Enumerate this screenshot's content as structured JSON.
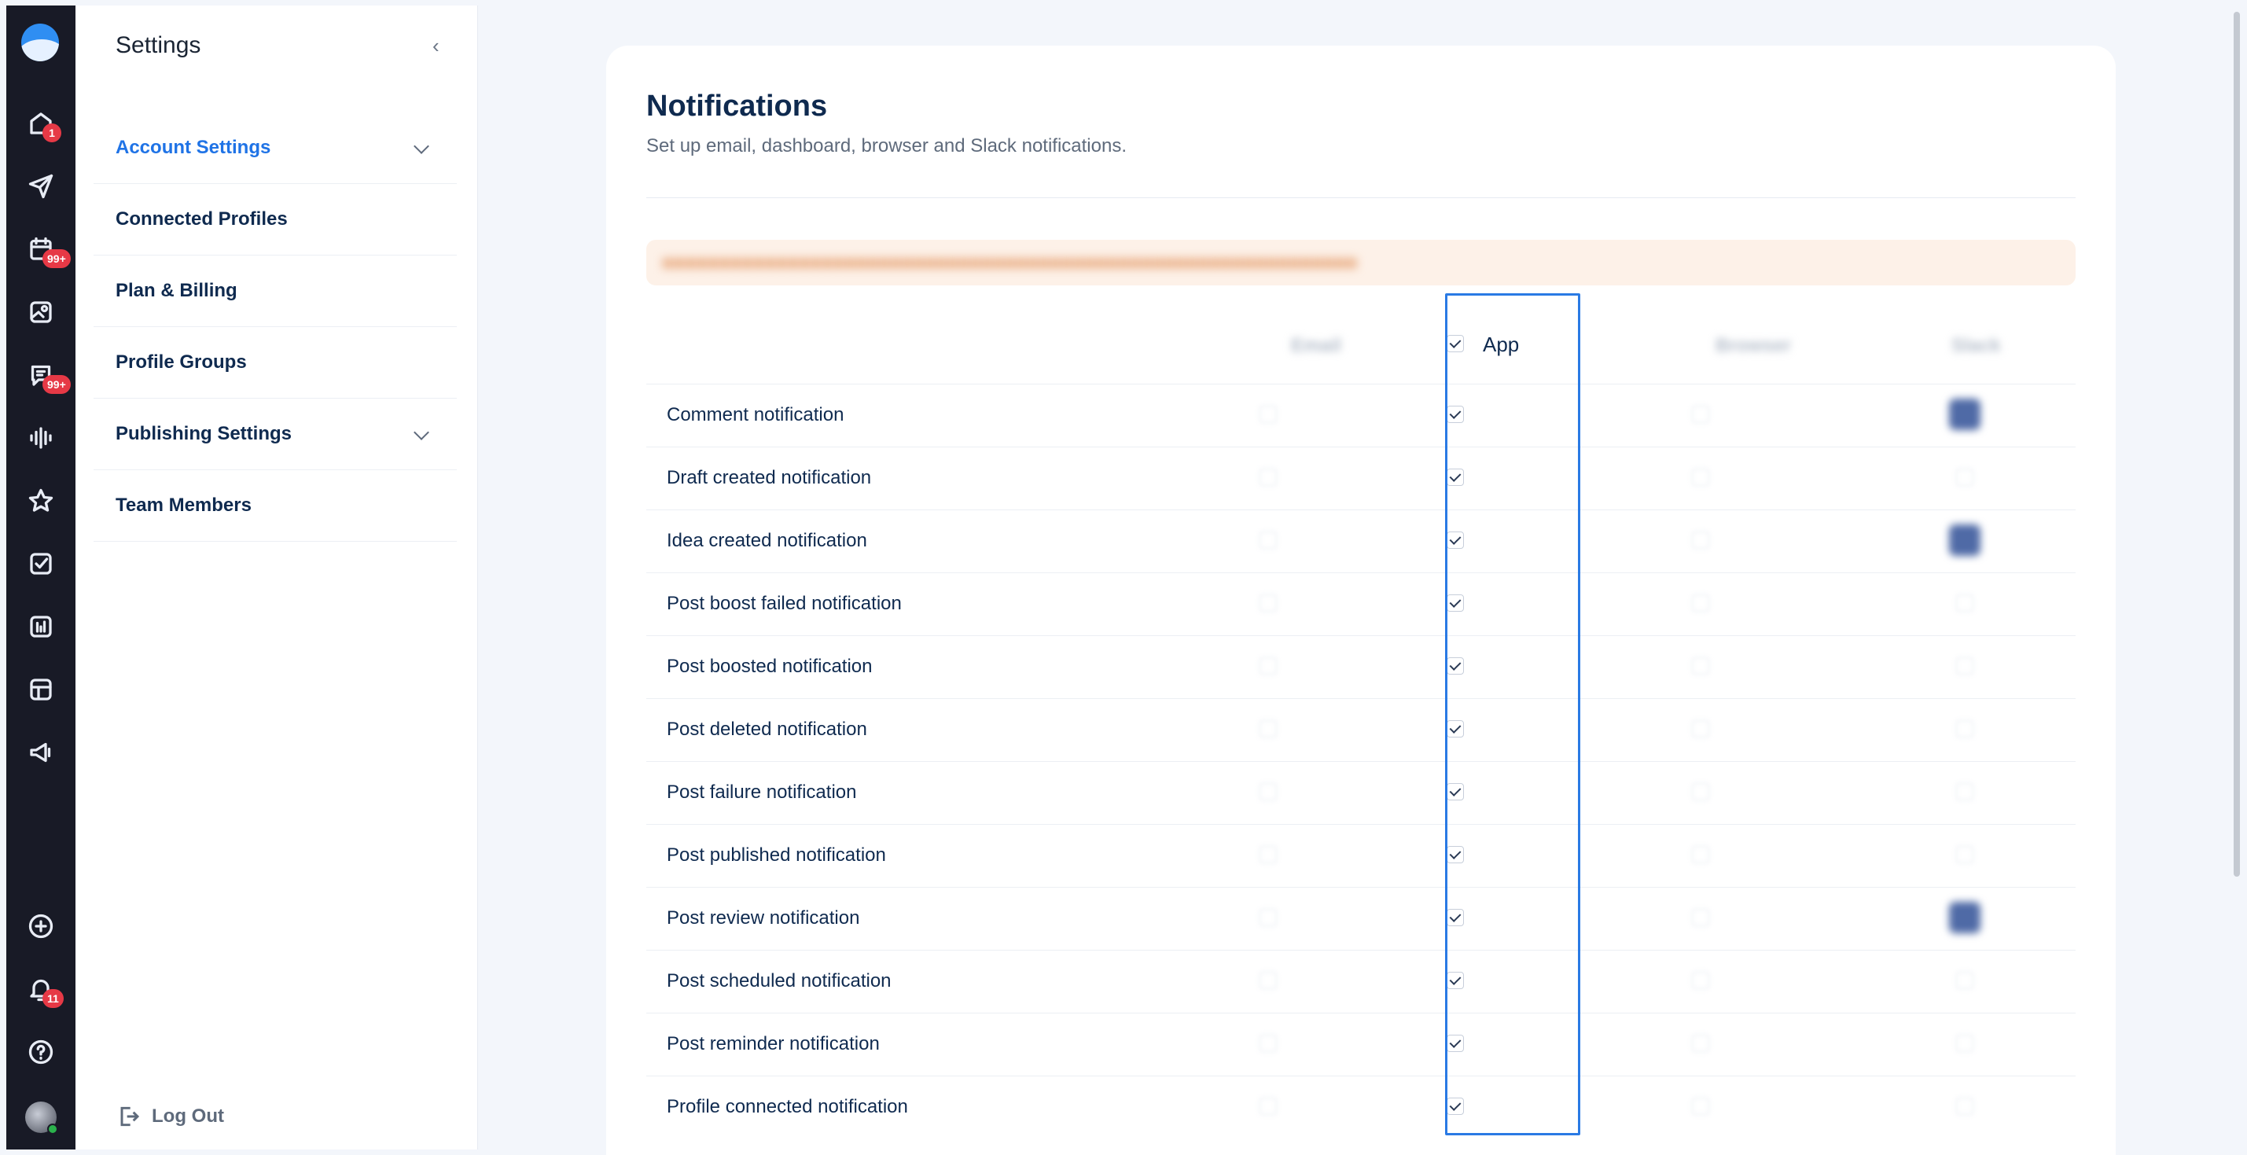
{
  "rail": {
    "items": [
      {
        "icon": "home-icon",
        "badge": "1"
      },
      {
        "icon": "send-icon",
        "badge": ""
      },
      {
        "icon": "calendar-icon",
        "badge": "99+"
      },
      {
        "icon": "media-icon",
        "badge": ""
      },
      {
        "icon": "chat-icon",
        "badge": "99+"
      },
      {
        "icon": "waveform-icon",
        "badge": ""
      },
      {
        "icon": "star-icon",
        "badge": ""
      },
      {
        "icon": "task-check-icon",
        "badge": ""
      },
      {
        "icon": "analytics-icon",
        "badge": ""
      },
      {
        "icon": "layout-icon",
        "badge": ""
      },
      {
        "icon": "megaphone-icon",
        "badge": ""
      }
    ],
    "bottom": [
      {
        "icon": "add-circle-icon",
        "badge": ""
      },
      {
        "icon": "bell-icon",
        "badge": "11"
      },
      {
        "icon": "help-icon",
        "badge": ""
      }
    ]
  },
  "settings": {
    "title": "Settings",
    "menu": [
      {
        "label": "Account Settings",
        "active": true,
        "expandable": true
      },
      {
        "label": "Connected Profiles",
        "active": false,
        "expandable": false
      },
      {
        "label": "Plan & Billing",
        "active": false,
        "expandable": false
      },
      {
        "label": "Profile Groups",
        "active": false,
        "expandable": false
      },
      {
        "label": "Publishing Settings",
        "active": false,
        "expandable": true
      },
      {
        "label": "Team Members",
        "active": false,
        "expandable": false
      }
    ],
    "logout_label": "Log Out"
  },
  "main": {
    "title": "Notifications",
    "subtitle": "Set up email, dashboard, browser and Slack notifications.",
    "columns": {
      "app": "App"
    },
    "rows": [
      "Comment notification",
      "Draft created notification",
      "Idea created notification",
      "Post boost failed notification",
      "Post boosted notification",
      "Post deleted notification",
      "Post failure notification",
      "Post published notification",
      "Post review notification",
      "Post scheduled notification",
      "Post reminder notification",
      "Profile connected notification"
    ]
  },
  "colors": {
    "accent": "#1f73e6",
    "highlight_border": "#2a7ae4",
    "rail_bg": "#181a26",
    "badge": "#e63946"
  }
}
